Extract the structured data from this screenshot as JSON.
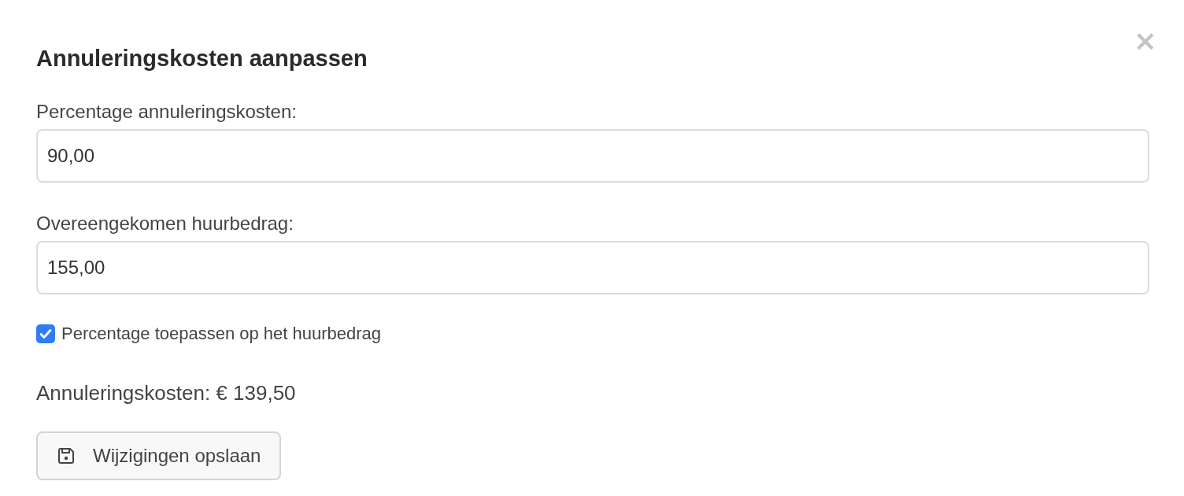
{
  "dialog": {
    "title": "Annuleringskosten aanpassen",
    "close": "×",
    "fields": [
      {
        "label": "Percentage annuleringskosten:",
        "value": "90,00"
      },
      {
        "label": "Overeengekomen huurbedrag:",
        "value": "155,00"
      }
    ],
    "checkbox": {
      "label": "Percentage toepassen op het huurbedrag",
      "checked": true
    },
    "total": "Annuleringskosten: € 139,50",
    "button": "Wijzigingen opslaan"
  }
}
